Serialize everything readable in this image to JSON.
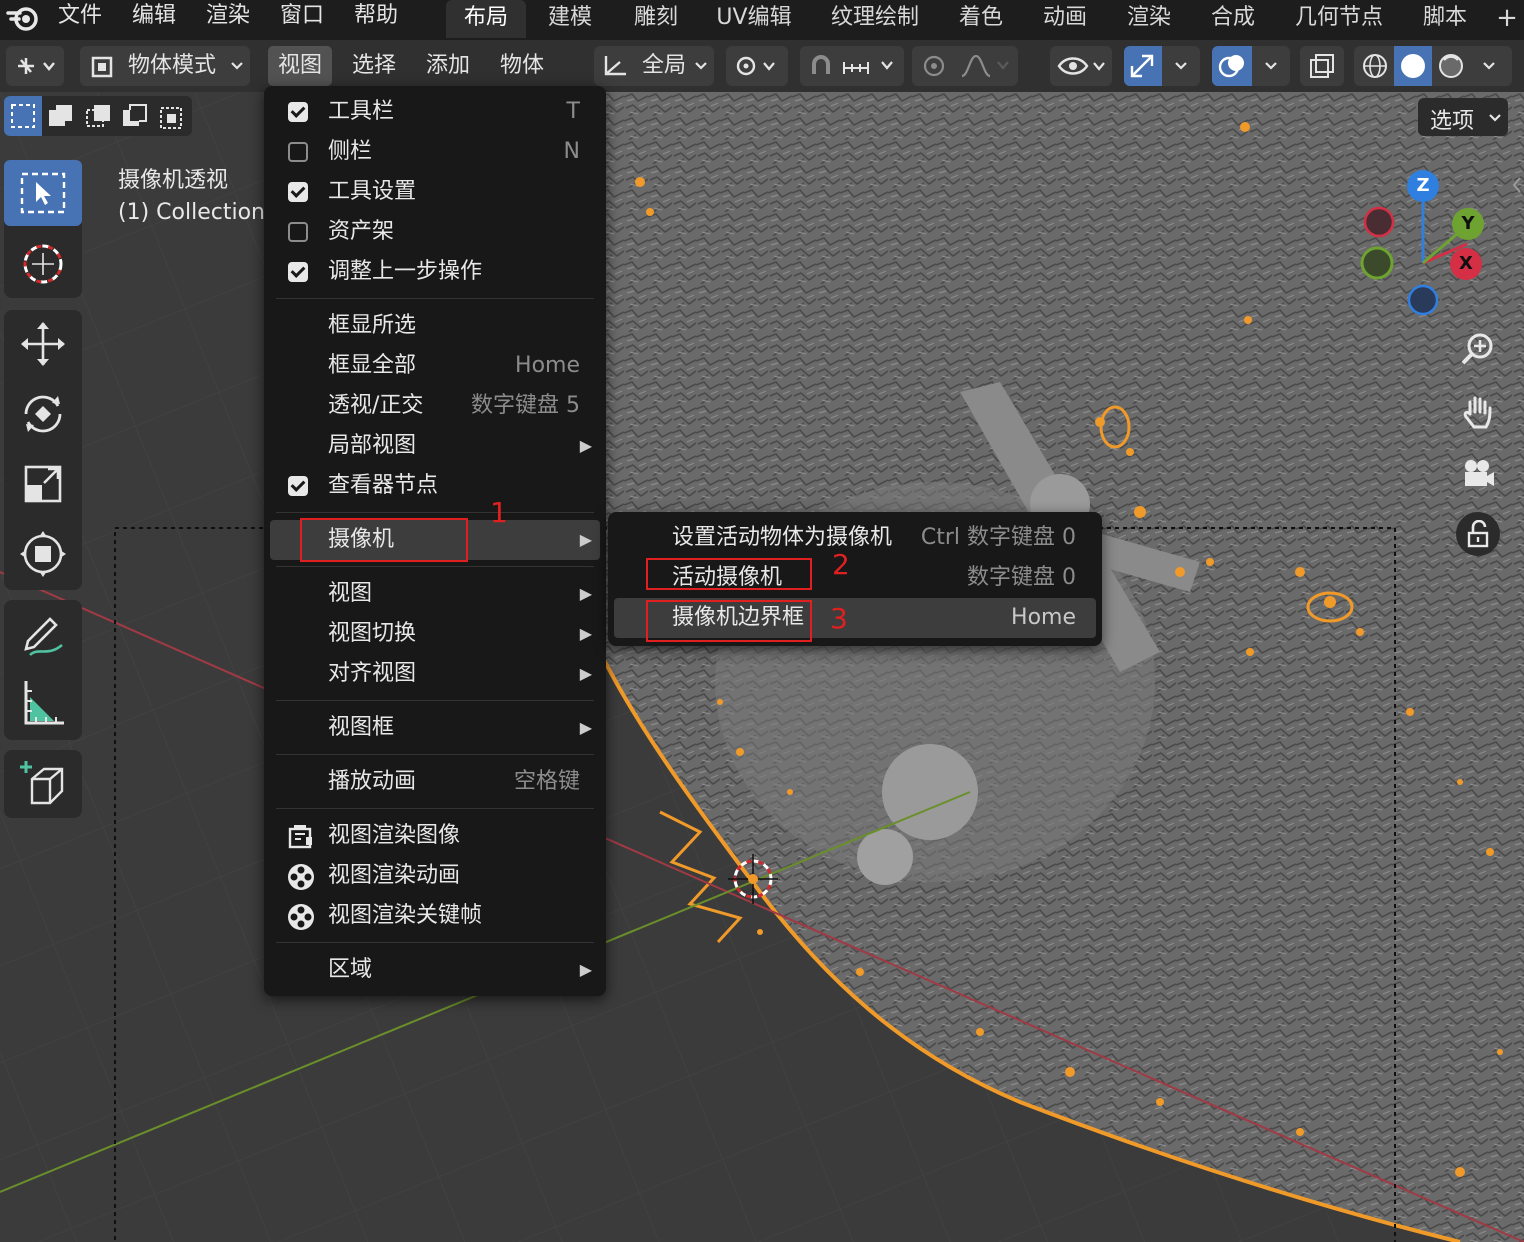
{
  "menubar": {
    "items": [
      "文件",
      "编辑",
      "渲染",
      "窗口",
      "帮助"
    ],
    "workspaces": [
      "布局",
      "建模",
      "雕刻",
      "UV编辑",
      "纹理绘制",
      "着色",
      "动画",
      "渲染",
      "合成",
      "几何节点",
      "脚本"
    ],
    "active_workspace": "布局",
    "add_label": "+"
  },
  "header": {
    "mode_label": "物体模式",
    "menus": [
      "视图",
      "选择",
      "添加",
      "物体"
    ],
    "active_menu": "视图",
    "transform_orientation": "全局",
    "options_label": "选项"
  },
  "viewport": {
    "view_name": "摄像机透视",
    "collection": "(1) Collection"
  },
  "view_menu": {
    "items": [
      {
        "label": "工具栏",
        "shortcut": "T",
        "check": "on"
      },
      {
        "label": "侧栏",
        "shortcut": "N",
        "check": "off"
      },
      {
        "label": "工具设置",
        "shortcut": "",
        "check": "on"
      },
      {
        "label": "资产架",
        "shortcut": "",
        "check": "off"
      },
      {
        "label": "调整上一步操作",
        "shortcut": "",
        "check": "on"
      },
      {
        "label": "框显所选",
        "shortcut": ""
      },
      {
        "label": "框显全部",
        "shortcut": "Home"
      },
      {
        "label": "透视/正交",
        "shortcut": "数字键盘 5"
      },
      {
        "label": "局部视图",
        "shortcut": "",
        "submenu": true
      },
      {
        "label": "查看器节点",
        "shortcut": "",
        "check": "on"
      },
      {
        "label": "摄像机",
        "shortcut": "",
        "submenu": true
      },
      {
        "label": "视图",
        "shortcut": "",
        "submenu": true
      },
      {
        "label": "视图切换",
        "shortcut": "",
        "submenu": true
      },
      {
        "label": "对齐视图",
        "shortcut": "",
        "submenu": true
      },
      {
        "label": "视图框",
        "shortcut": "",
        "submenu": true
      },
      {
        "label": "播放动画",
        "shortcut": "空格键"
      },
      {
        "label": "视图渲染图像",
        "shortcut": "",
        "icon": "render-image-icon"
      },
      {
        "label": "视图渲染动画",
        "shortcut": "",
        "icon": "film-reel-icon"
      },
      {
        "label": "视图渲染关键帧",
        "shortcut": "",
        "icon": "film-reel-icon"
      },
      {
        "label": "区域",
        "shortcut": "",
        "submenu": true
      }
    ]
  },
  "camera_submenu": {
    "items": [
      {
        "label": "设置活动物体为摄像机",
        "shortcut": "Ctrl 数字键盘 0"
      },
      {
        "label": "活动摄像机",
        "shortcut": "数字键盘 0"
      },
      {
        "label": "摄像机边界框",
        "shortcut": "Home"
      }
    ]
  },
  "annotations": [
    "1",
    "2",
    "3"
  ],
  "gizmo": {
    "z": "Z",
    "y": "Y",
    "x": "X"
  },
  "colors": {
    "accent_blue": "#4772b3",
    "annotation_red": "#e02020",
    "selection_orange": "#f09a2a",
    "menu_bg": "#181818"
  }
}
